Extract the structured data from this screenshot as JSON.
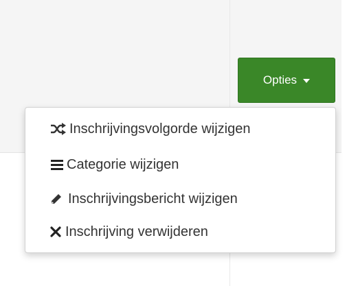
{
  "options_button": {
    "label": "Opties",
    "color": "#3a8728"
  },
  "dropdown": {
    "items": [
      {
        "label": "Inschrijvingsvolgorde wijzigen",
        "icon": "shuffle-icon"
      },
      {
        "label": "Categorie wijzigen",
        "icon": "list-icon",
        "highlighted": true
      },
      {
        "label": "Inschrijvingsbericht wijzigen",
        "icon": "pencil-icon"
      },
      {
        "label": "Inschrijving verwijderen",
        "icon": "times-icon"
      }
    ]
  },
  "highlight_color": "#f5f72a"
}
